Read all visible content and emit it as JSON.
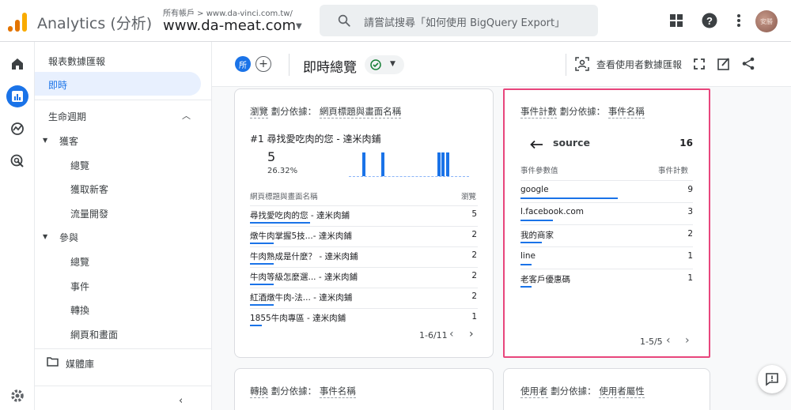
{
  "app": {
    "name": "Analytics (分析)",
    "account_crumb": "所有帳戶 > www.da-vinci.com.tw/",
    "property": "www.da-meat.com",
    "search_placeholder": "請嘗試搜尋「如何使用 BigQuery Export」",
    "avatar_text": "安勝"
  },
  "nav": {
    "section_reports": "報表數據匯報",
    "realtime": "即時",
    "lifecycle": "生命週期",
    "acquisition": "獲客",
    "acq_items": [
      "總覽",
      "獲取新客",
      "流量開發"
    ],
    "engagement": "參與",
    "eng_items": [
      "總覽",
      "事件",
      "轉換",
      "網頁和畫面"
    ],
    "library": "媒體庫"
  },
  "header": {
    "comparison_chip": "所",
    "title": "即時總覽",
    "view_user_snapshot": "查看使用者數據匯報"
  },
  "pages_card": {
    "title_metric": "瀏覽",
    "title_by": "劃分依據：",
    "title_dim": "網頁標題與畫面名稱",
    "top_label": "#1  尋找愛吃肉的您 - 達米肉鋪",
    "top_value": "5",
    "top_pct": "26.32%",
    "col_dim": "網頁標題與畫面名稱",
    "col_metric": "瀏覽",
    "rows": [
      {
        "label": "尋找愛吃肉的您 - 達米肉鋪",
        "value": "5",
        "share": 1.0
      },
      {
        "label": "燉牛肉掌握5技...- 達米肉鋪",
        "value": "2",
        "share": 0.4
      },
      {
        "label": "牛肉熟成是什麼？ - 達米肉鋪",
        "value": "2",
        "share": 0.4
      },
      {
        "label": "牛肉等級怎麼選... - 達米肉鋪",
        "value": "2",
        "share": 0.4
      },
      {
        "label": "紅酒燉牛肉-法... - 達米肉鋪",
        "value": "2",
        "share": 0.4
      },
      {
        "label": "1855牛肉專區 - 達米肉鋪",
        "value": "1",
        "share": 0.2
      }
    ],
    "pager": "1-6/11"
  },
  "events_card": {
    "title_metric": "事件計數",
    "title_by": "劃分依據：",
    "title_dim": "事件名稱",
    "drill_label": "source",
    "drill_total": "16",
    "col_dim": "事件參數值",
    "col_metric": "事件計數",
    "rows": [
      {
        "label": "google",
        "value": "9",
        "share": 1.0
      },
      {
        "label": "l.facebook.com",
        "value": "3",
        "share": 0.333
      },
      {
        "label": "我的商家",
        "value": "2",
        "share": 0.222
      },
      {
        "label": "line",
        "value": "1",
        "share": 0.111
      },
      {
        "label": "老客戶優惠碼",
        "value": "1",
        "share": 0.111
      }
    ],
    "pager": "1-5/5"
  },
  "conversions_card": {
    "title_metric": "轉換",
    "title_by": "劃分依據：",
    "title_dim": "事件名稱"
  },
  "users_card": {
    "title_metric": "使用者",
    "title_by": "劃分依據：",
    "title_dim": "使用者屬性"
  },
  "colors": {
    "accent": "#1a73e8",
    "highlight": "#e8467c",
    "logo_orange": "#e37400",
    "logo_yellow": "#f9ab00"
  }
}
